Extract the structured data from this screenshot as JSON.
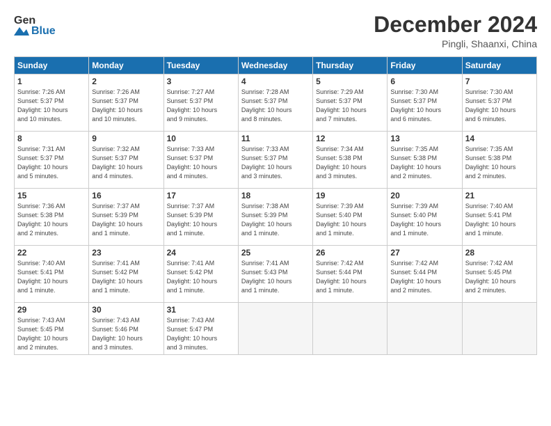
{
  "header": {
    "logo_general": "General",
    "logo_blue": "Blue",
    "month": "December 2024",
    "location": "Pingli, Shaanxi, China"
  },
  "weekdays": [
    "Sunday",
    "Monday",
    "Tuesday",
    "Wednesday",
    "Thursday",
    "Friday",
    "Saturday"
  ],
  "weeks": [
    [
      {
        "day": "1",
        "info": "Sunrise: 7:26 AM\nSunset: 5:37 PM\nDaylight: 10 hours\nand 10 minutes."
      },
      {
        "day": "2",
        "info": "Sunrise: 7:26 AM\nSunset: 5:37 PM\nDaylight: 10 hours\nand 10 minutes."
      },
      {
        "day": "3",
        "info": "Sunrise: 7:27 AM\nSunset: 5:37 PM\nDaylight: 10 hours\nand 9 minutes."
      },
      {
        "day": "4",
        "info": "Sunrise: 7:28 AM\nSunset: 5:37 PM\nDaylight: 10 hours\nand 8 minutes."
      },
      {
        "day": "5",
        "info": "Sunrise: 7:29 AM\nSunset: 5:37 PM\nDaylight: 10 hours\nand 7 minutes."
      },
      {
        "day": "6",
        "info": "Sunrise: 7:30 AM\nSunset: 5:37 PM\nDaylight: 10 hours\nand 6 minutes."
      },
      {
        "day": "7",
        "info": "Sunrise: 7:30 AM\nSunset: 5:37 PM\nDaylight: 10 hours\nand 6 minutes."
      }
    ],
    [
      {
        "day": "8",
        "info": "Sunrise: 7:31 AM\nSunset: 5:37 PM\nDaylight: 10 hours\nand 5 minutes."
      },
      {
        "day": "9",
        "info": "Sunrise: 7:32 AM\nSunset: 5:37 PM\nDaylight: 10 hours\nand 4 minutes."
      },
      {
        "day": "10",
        "info": "Sunrise: 7:33 AM\nSunset: 5:37 PM\nDaylight: 10 hours\nand 4 minutes."
      },
      {
        "day": "11",
        "info": "Sunrise: 7:33 AM\nSunset: 5:37 PM\nDaylight: 10 hours\nand 3 minutes."
      },
      {
        "day": "12",
        "info": "Sunrise: 7:34 AM\nSunset: 5:38 PM\nDaylight: 10 hours\nand 3 minutes."
      },
      {
        "day": "13",
        "info": "Sunrise: 7:35 AM\nSunset: 5:38 PM\nDaylight: 10 hours\nand 2 minutes."
      },
      {
        "day": "14",
        "info": "Sunrise: 7:35 AM\nSunset: 5:38 PM\nDaylight: 10 hours\nand 2 minutes."
      }
    ],
    [
      {
        "day": "15",
        "info": "Sunrise: 7:36 AM\nSunset: 5:38 PM\nDaylight: 10 hours\nand 2 minutes."
      },
      {
        "day": "16",
        "info": "Sunrise: 7:37 AM\nSunset: 5:39 PM\nDaylight: 10 hours\nand 1 minute."
      },
      {
        "day": "17",
        "info": "Sunrise: 7:37 AM\nSunset: 5:39 PM\nDaylight: 10 hours\nand 1 minute."
      },
      {
        "day": "18",
        "info": "Sunrise: 7:38 AM\nSunset: 5:39 PM\nDaylight: 10 hours\nand 1 minute."
      },
      {
        "day": "19",
        "info": "Sunrise: 7:39 AM\nSunset: 5:40 PM\nDaylight: 10 hours\nand 1 minute."
      },
      {
        "day": "20",
        "info": "Sunrise: 7:39 AM\nSunset: 5:40 PM\nDaylight: 10 hours\nand 1 minute."
      },
      {
        "day": "21",
        "info": "Sunrise: 7:40 AM\nSunset: 5:41 PM\nDaylight: 10 hours\nand 1 minute."
      }
    ],
    [
      {
        "day": "22",
        "info": "Sunrise: 7:40 AM\nSunset: 5:41 PM\nDaylight: 10 hours\nand 1 minute."
      },
      {
        "day": "23",
        "info": "Sunrise: 7:41 AM\nSunset: 5:42 PM\nDaylight: 10 hours\nand 1 minute."
      },
      {
        "day": "24",
        "info": "Sunrise: 7:41 AM\nSunset: 5:42 PM\nDaylight: 10 hours\nand 1 minute."
      },
      {
        "day": "25",
        "info": "Sunrise: 7:41 AM\nSunset: 5:43 PM\nDaylight: 10 hours\nand 1 minute."
      },
      {
        "day": "26",
        "info": "Sunrise: 7:42 AM\nSunset: 5:44 PM\nDaylight: 10 hours\nand 1 minute."
      },
      {
        "day": "27",
        "info": "Sunrise: 7:42 AM\nSunset: 5:44 PM\nDaylight: 10 hours\nand 2 minutes."
      },
      {
        "day": "28",
        "info": "Sunrise: 7:42 AM\nSunset: 5:45 PM\nDaylight: 10 hours\nand 2 minutes."
      }
    ],
    [
      {
        "day": "29",
        "info": "Sunrise: 7:43 AM\nSunset: 5:45 PM\nDaylight: 10 hours\nand 2 minutes."
      },
      {
        "day": "30",
        "info": "Sunrise: 7:43 AM\nSunset: 5:46 PM\nDaylight: 10 hours\nand 3 minutes."
      },
      {
        "day": "31",
        "info": "Sunrise: 7:43 AM\nSunset: 5:47 PM\nDaylight: 10 hours\nand 3 minutes."
      },
      {
        "day": "",
        "info": ""
      },
      {
        "day": "",
        "info": ""
      },
      {
        "day": "",
        "info": ""
      },
      {
        "day": "",
        "info": ""
      }
    ]
  ]
}
